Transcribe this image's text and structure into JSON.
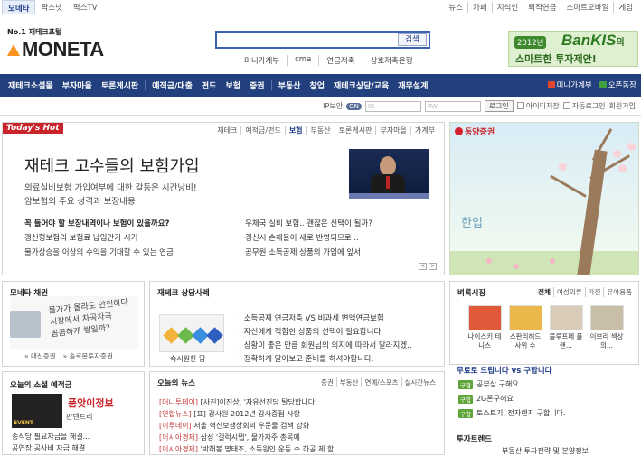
{
  "top": {
    "tabs": [
      "모네타",
      "팍스넷",
      "팍스TV"
    ],
    "links": [
      "뉴스",
      "카페",
      "지식인",
      "퇴직연금",
      "스마트모바일",
      "게임"
    ]
  },
  "logo": {
    "tagline": "No.1 재테크포털",
    "word": "MONETA"
  },
  "search": {
    "button": "검색",
    "links": [
      "미니가계부",
      "cma",
      "연금저축",
      "상호저축은행"
    ]
  },
  "banner": {
    "year": "2012년",
    "brand": "BanKIS",
    "suffix": "의",
    "slogan": "스마트한 투자제안!"
  },
  "nav": {
    "items": [
      "재테크소셜몰",
      "부자마을",
      "토론게시판",
      "예적금/대출",
      "펀드",
      "보험",
      "증권",
      "부동산",
      "창업",
      "재테크상담/교육",
      "재무설계"
    ],
    "right": [
      "미니가계부",
      "오픈동장"
    ]
  },
  "login": {
    "ip_label": "IP보안",
    "ip_badge": "ON",
    "id_ph": "ID",
    "pw_ph": "PW",
    "button": "로그인",
    "save_id": "아이디저장",
    "auto": "자동로그인",
    "join": "회원가입"
  },
  "hot": {
    "label": "Today's Hot",
    "tabs": [
      "재테크",
      "예적금/펀드",
      "보험",
      "부동산",
      "토론게시판",
      "부자마을",
      "가계부"
    ],
    "active_tab": "보험",
    "title": "재테크 고수들의 보험가입",
    "sub1": "의료실비보험 가입여부에 대한 갈등은 시간낭비!",
    "sub2": "암보험의 주요 성격과 보장내용",
    "left": [
      "꼭 들어야 할 보장내역이나 보험이 있을까요?",
      "갱신형보험의 보험료 납입만기 시기",
      "물가상승을 이상의 수익을 기대할 수 있는 연금"
    ],
    "right": [
      "우체국 실비 보험.. 괜찮은 선택이 될까?",
      "갱신시 손해율이 새로 반영되므로 ..",
      "공무원 소득공제 상품의 가입에 앞서"
    ],
    "pager": [
      "<",
      ">"
    ]
  },
  "ad": {
    "brand": "동양증권",
    "caption": "한입"
  },
  "moneta_chat": {
    "title": "모네타 채권",
    "note": [
      "물가가 올라도 안전하다",
      "시장에서 차곡차곡",
      "꼼꼼하게 쌓일까?"
    ],
    "links": [
      "» 대신증권",
      "» 솔로몬투자증권"
    ]
  },
  "consult": {
    "title": "재테크 상담사례",
    "caption": "속시원한 답",
    "items": [
      "소득공제 연금저축 VS 비과세 변액연금보험",
      "자신에게 적합한 상품의 선택이 필요합니다",
      "상황이 좋은 만큼 회원님의 의지에 따라서 달라지겠..",
      "정확하게 알아보고 준비를 하셔야합니다."
    ]
  },
  "social": {
    "title": "오늘의 소셜 예적금",
    "img_label": "EVENT",
    "price": "품앗이정보",
    "brand": "판텐트리",
    "items": [
      "종식당 필요자금을 해결...",
      "공연장 공사비 자금 해결"
    ]
  },
  "news": {
    "title": "오늘의 뉴스",
    "tabs": [
      "증권",
      "부동산",
      "연예/스포츠",
      "실시간뉴스"
    ],
    "items": [
      {
        "src": "[머니투데이]",
        "text": "[사진]이진상, '자유선진당 탈당합니다'"
      },
      {
        "src": "[연합뉴스]",
        "text": "[표] 감사원 2012년 감사중점 사항"
      },
      {
        "src": "[이투데이]",
        "text": "서울 혁신보생상회의 우문물 검색 강화"
      },
      {
        "src": "[이시아경제]",
        "text": "삼성 '갤럭시탭', 물가자주 총목에"
      },
      {
        "src": "[이시아경제]",
        "text": "'박해봉 명태조, 소득원인 운동 수 하공 제 함..."
      }
    ]
  },
  "market": {
    "title": "벼룩시장",
    "tabs": [
      "전체",
      "여성의류",
      "가전",
      "유아용품"
    ],
    "items": [
      "나이스키 테니스",
      "스판리허드 사위 수",
      "블루프페 플랜...",
      "이브리 색상의..."
    ]
  },
  "qa": {
    "title": "무료로 드립니다 vs 구합니다",
    "badge": "구함",
    "items": [
      "공부상 구해요",
      "2G폰구해요",
      "토스트기, 전자렌지 구합니다."
    ]
  },
  "trend": {
    "title": "투자트렌드",
    "item": "부동산 투자전략 및 분양정보"
  },
  "colors": {
    "nav": "#23407e",
    "accent_red": "#c8242a",
    "accent_orange": "#f7931e",
    "green": "#2b7a1e"
  }
}
